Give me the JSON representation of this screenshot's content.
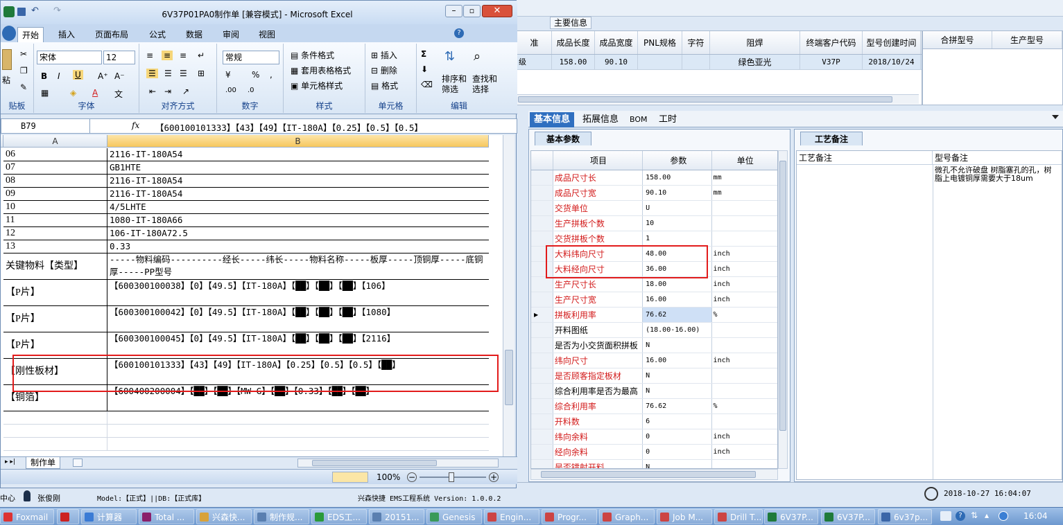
{
  "erp": {
    "main_info_tab": "主要信息",
    "top_columns": [
      "准",
      "成品长度",
      "成品宽度",
      "PNL规格",
      "字符",
      "阻焊",
      "终端客户代码",
      "型号创建时间"
    ],
    "top_row": [
      "级",
      "158.00",
      "90.10",
      "",
      "",
      "绿色亚光",
      "V37P",
      "2018/10/24"
    ],
    "right_columns": [
      "合拼型号",
      "生产型号"
    ],
    "tabs": [
      "基本信息",
      "拓展信息",
      "BOM",
      "工时"
    ],
    "param_tab": "基本参数",
    "param_headers": [
      "项目",
      "参数",
      "单位"
    ],
    "params": [
      {
        "name": "成品尺寸长",
        "value": "158.00",
        "unit": "mm",
        "red": true
      },
      {
        "name": "成品尺寸宽",
        "value": "90.10",
        "unit": "mm",
        "red": true
      },
      {
        "name": "交货单位",
        "value": "U",
        "unit": "",
        "red": true
      },
      {
        "name": "生产拼板个数",
        "value": "10",
        "unit": "",
        "red": true
      },
      {
        "name": "交货拼板个数",
        "value": "1",
        "unit": "",
        "red": true
      },
      {
        "name": "大料纬向尺寸",
        "value": "48.00",
        "unit": "inch",
        "red": true
      },
      {
        "name": "大料经向尺寸",
        "value": "36.00",
        "unit": "inch",
        "red": true
      },
      {
        "name": "生产尺寸长",
        "value": "18.00",
        "unit": "inch",
        "red": true
      },
      {
        "name": "生产尺寸宽",
        "value": "16.00",
        "unit": "inch",
        "red": true
      },
      {
        "name": "拼板利用率",
        "value": "76.62",
        "unit": "%",
        "red": true
      },
      {
        "name": "开料图纸",
        "value": "(18.00-16.00)",
        "unit": "",
        "red": false
      },
      {
        "name": "是否为小交货面积拼板",
        "value": "N",
        "unit": "",
        "red": false
      },
      {
        "name": "纬向尺寸",
        "value": "16.00",
        "unit": "inch",
        "red": true
      },
      {
        "name": "是否顾客指定板材",
        "value": "N",
        "unit": "",
        "red": true
      },
      {
        "name": "综合利用率是否为最高",
        "value": "N",
        "unit": "",
        "red": false
      },
      {
        "name": "综合利用率",
        "value": "76.62",
        "unit": "%",
        "red": true
      },
      {
        "name": "开料数",
        "value": "6",
        "unit": "",
        "red": true
      },
      {
        "name": "纬向余料",
        "value": "0",
        "unit": "inch",
        "red": true
      },
      {
        "name": "经向余料",
        "value": "0",
        "unit": "inch",
        "red": true
      },
      {
        "name": "是否镭射开料",
        "value": "N",
        "unit": "",
        "red": true
      }
    ],
    "notes_tab": "工艺备注",
    "notes_headers": [
      "工艺备注",
      "型号备注"
    ],
    "model_note": "微孔不允许破盘 树脂塞孔的孔，树脂上电镀铜厚需要大于18um",
    "datetime": "2018-10-27 16:04:07",
    "status_left": "Model:【正式】||DB:【正式库】",
    "status_center": "兴森快捷 EMS工程系统 Version: 1.0.0.2",
    "user": "张俊刚",
    "center_label": "中心"
  },
  "excel": {
    "title": "6V37P01PA0制作单 [兼容模式] - Microsoft Excel",
    "ribbon_tabs": [
      "开始",
      "插入",
      "页面布局",
      "公式",
      "数据",
      "审阅",
      "视图"
    ],
    "font_name": "宋体",
    "font_size": "12",
    "number_format": "常规",
    "groups": {
      "clipboard": "贴板",
      "font": "字体",
      "align": "对齐方式",
      "number": "数字",
      "style": "样式",
      "cells": "单元格",
      "edit": "编辑"
    },
    "style_items": [
      "条件格式",
      "套用表格格式",
      "单元格样式"
    ],
    "cell_items": [
      "插入",
      "删除",
      "格式"
    ],
    "edit_items": [
      "排序和筛选",
      "查找和选择"
    ],
    "paste_label": "粘",
    "cell_ref": "B79",
    "formula": "【600100101333】【43】【49】【IT-180A】【0.25】【0.5】【0.5】",
    "col_a": "A",
    "col_b": "B",
    "rows": [
      {
        "a": "06",
        "b": "2116-IT-180A54"
      },
      {
        "a": "07",
        "b": "GB1HTE"
      },
      {
        "a": "08",
        "b": "2116-IT-180A54"
      },
      {
        "a": "09",
        "b": "2116-IT-180A54"
      },
      {
        "a": "10",
        "b": "4/5LHTE"
      },
      {
        "a": "11",
        "b": "1080-IT-180A66"
      },
      {
        "a": "12",
        "b": "106-IT-180A72.5"
      },
      {
        "a": "13",
        "b": "0.33"
      },
      {
        "a": "关键物料【类型】",
        "b": "-----物料编码----------经长-----纬长-----物料名称-----板厚-----顶铜厚-----底铜厚-----PP型号"
      },
      {
        "a": "【P片】",
        "b": "【600300100038】【0】【49.5】【IT-180A】【██】【██】【██】【106】"
      },
      {
        "a": "【P片】",
        "b": "【600300100042】【0】【49.5】【IT-180A】【██】【██】【██】【1080】"
      },
      {
        "a": "【P片】",
        "b": "【600300100045】【0】【49.5】【IT-180A】【██】【██】【██】【2116】"
      },
      {
        "a": "【刚性板材】",
        "b": "【600100101333】【43】【49】【IT-180A】【0.25】【0.5】【0.5】【██】"
      },
      {
        "a": "【铜箔】",
        "b": "【600400200004】【██】【██】【MW-G】【██】【0.33】【██】【██】"
      }
    ],
    "sheet_tab": "制作单",
    "zoom": "100%"
  },
  "taskbar": {
    "items": [
      "Foxmail",
      "",
      "计算器",
      "Total ...",
      "兴森快...",
      "制作规...",
      "EDS工...",
      "20151...",
      "Genesis",
      "Engin...",
      "Progr...",
      "Graph...",
      "Job M...",
      "Drill T...",
      "6V37P...",
      "6V37P...",
      "6v37p..."
    ],
    "time": "16:04"
  }
}
